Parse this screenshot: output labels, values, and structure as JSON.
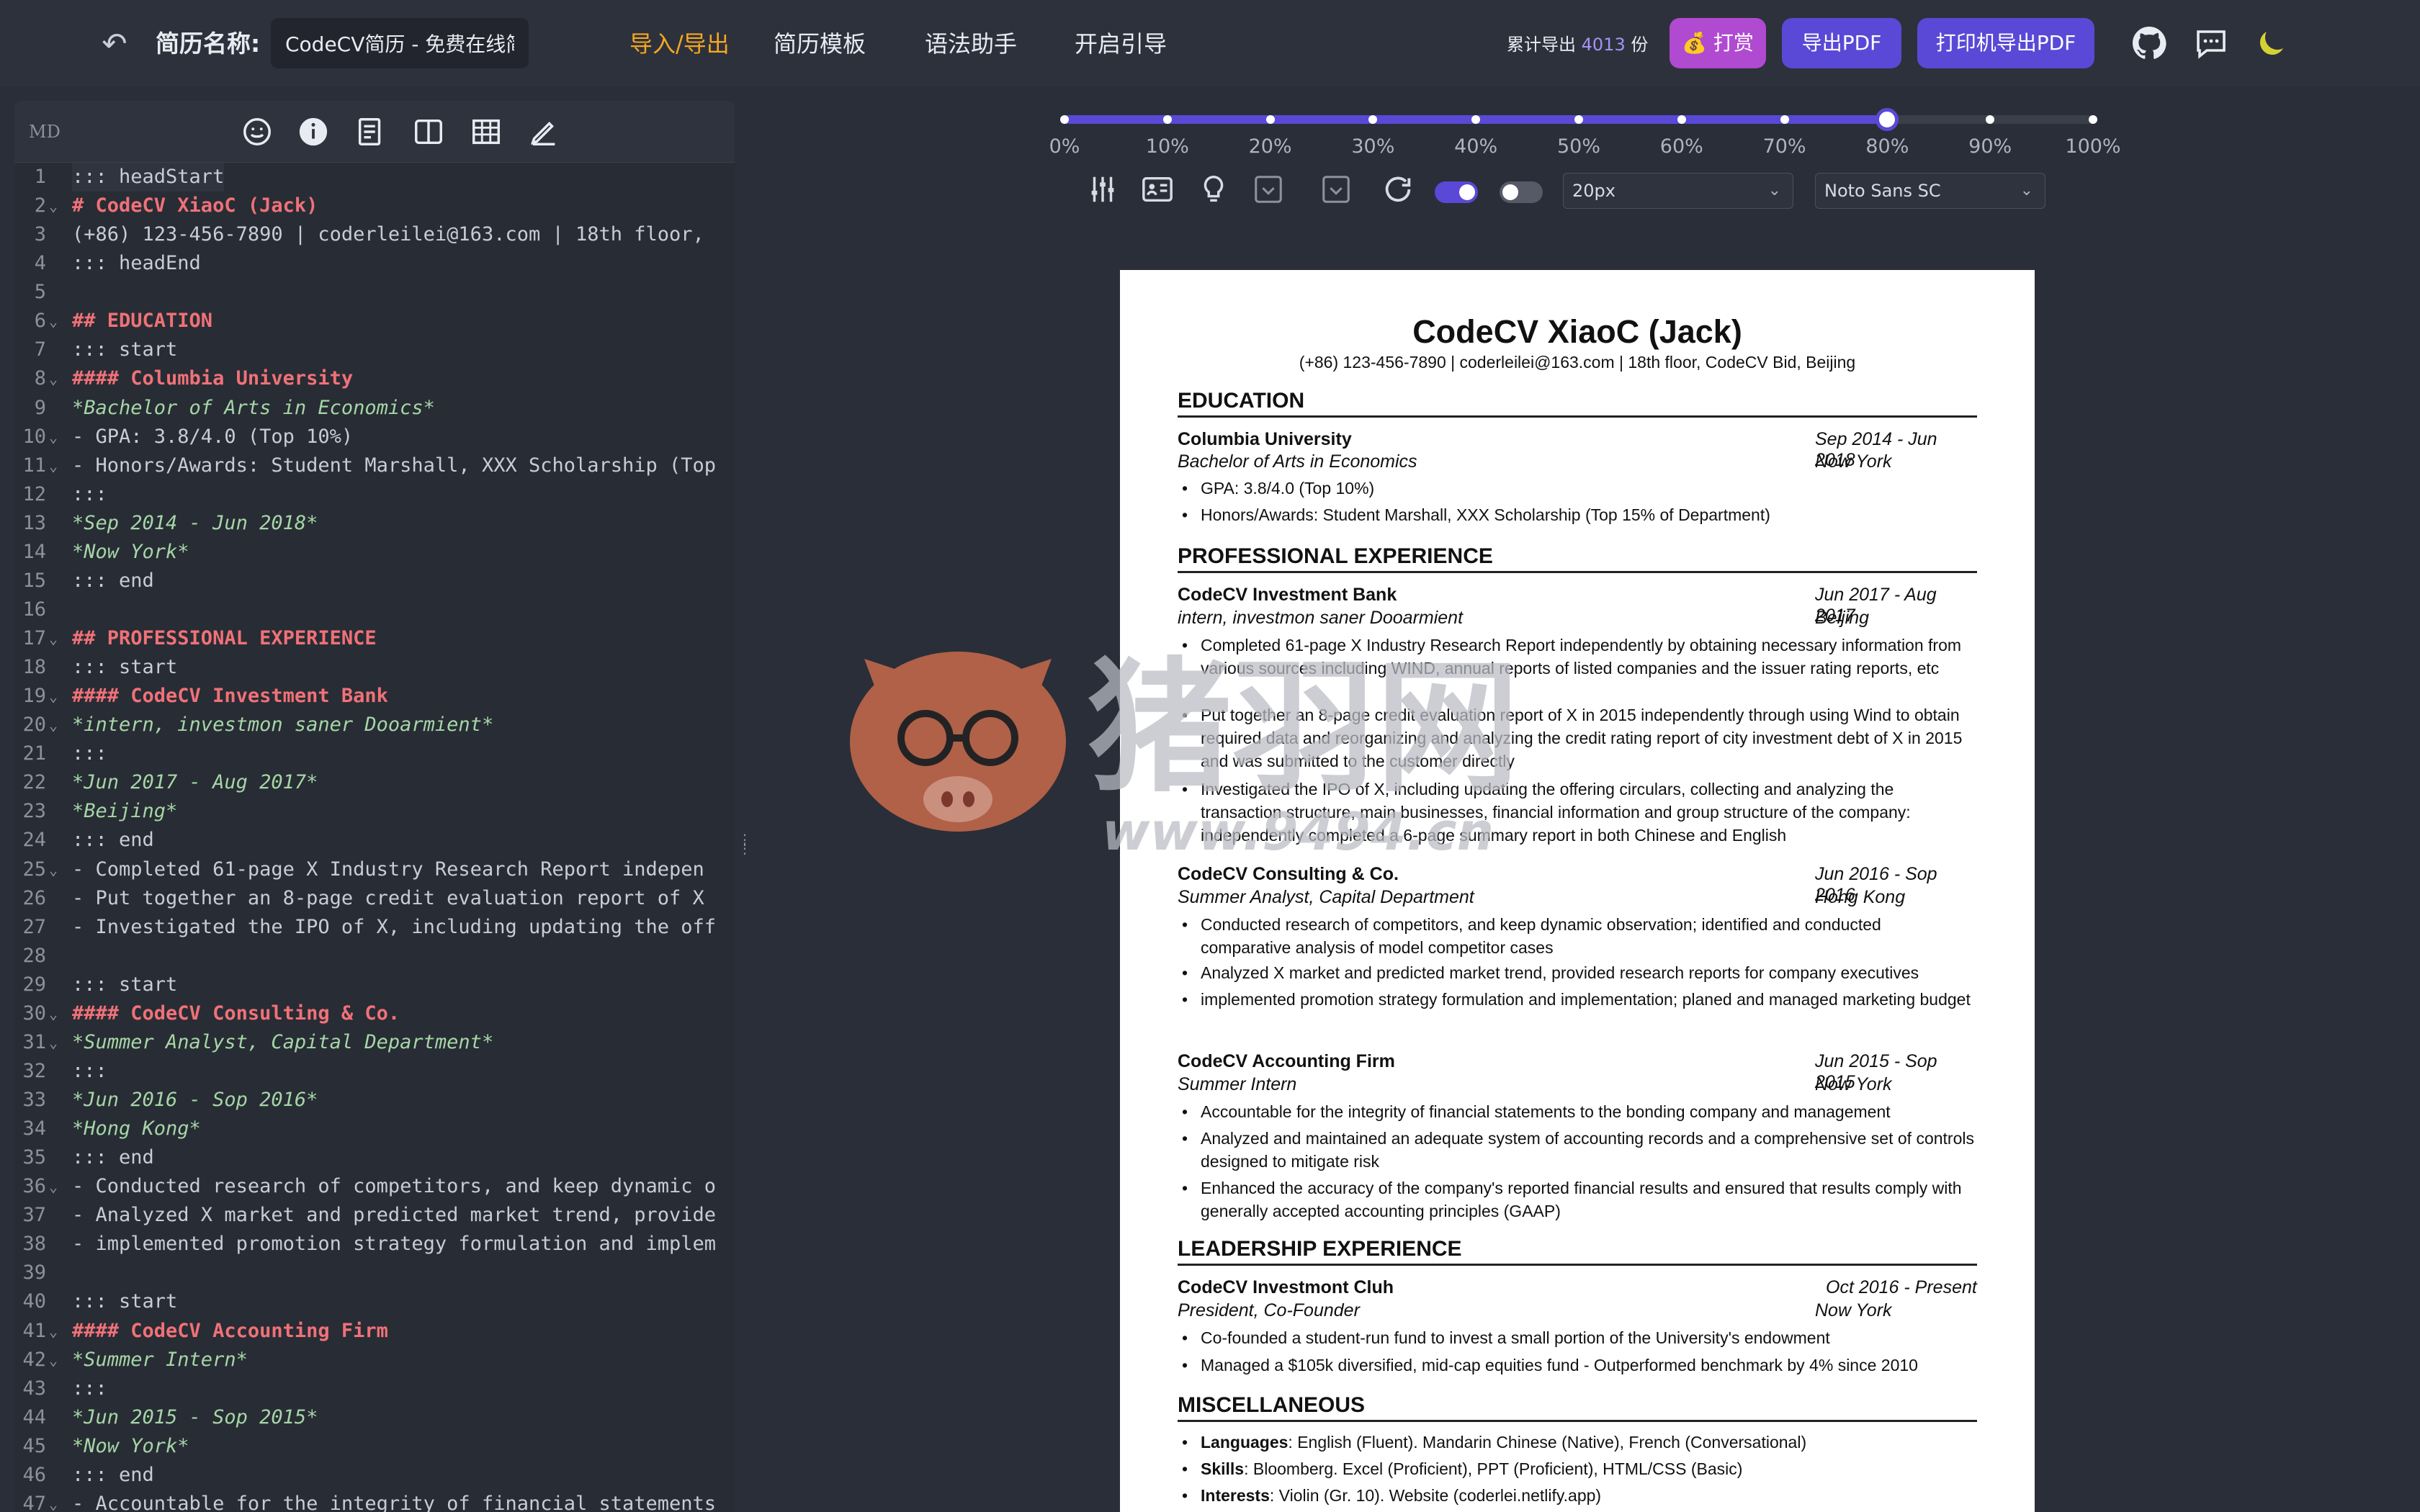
{
  "header": {
    "title_label": "简历名称:",
    "title_value": "CodeCV简历 - 免费在线简历",
    "nav": [
      "导入/导出",
      "简历模板",
      "语法助手",
      "开启引导"
    ],
    "export_prefix": "累计导出",
    "export_count": "4013",
    "export_suffix": "份",
    "buttons": {
      "reward": "打赏",
      "export_pdf": "导出PDF",
      "print_pdf": "打印机导出PDF"
    },
    "icons": [
      "back-icon",
      "github-icon",
      "chat-icon",
      "moon-icon"
    ],
    "accent": "#5a49d6"
  },
  "editor": {
    "mode_label": "MD",
    "toolbar_icons": [
      "emoji-icon",
      "info-icon",
      "document-icon",
      "columns-icon",
      "table-icon",
      "pen-icon"
    ],
    "lines": [
      {
        "n": "1",
        "f": "",
        "t": "::: headStart",
        "c": ""
      },
      {
        "n": "2",
        "f": "⌄",
        "t": "# CodeCV XiaoC (Jack)",
        "c": "h"
      },
      {
        "n": "3",
        "f": "",
        "t": "(+86) 123-456-7890 | coderleilei@163.com | 18th floor,",
        "c": ""
      },
      {
        "n": "4",
        "f": "",
        "t": "::: headEnd",
        "c": ""
      },
      {
        "n": "5",
        "f": "",
        "t": "",
        "c": ""
      },
      {
        "n": "6",
        "f": "⌄",
        "t": "## EDUCATION",
        "c": "h"
      },
      {
        "n": "7",
        "f": "",
        "t": "::: start",
        "c": ""
      },
      {
        "n": "8",
        "f": "⌄",
        "t": "#### Columbia University",
        "c": "h"
      },
      {
        "n": "9",
        "f": "",
        "t": "*Bachelor of Arts in Economics*",
        "c": "em"
      },
      {
        "n": "10",
        "f": "⌄",
        "t": "- GPA: 3.8/4.0 (Top 10%)",
        "c": ""
      },
      {
        "n": "11",
        "f": "⌄",
        "t": "- Honors/Awards: Student Marshall, XXX Scholarship (Top",
        "c": ""
      },
      {
        "n": "12",
        "f": "",
        "t": ":::",
        "c": ""
      },
      {
        "n": "13",
        "f": "",
        "t": "*Sep 2014 - Jun 2018*",
        "c": "em"
      },
      {
        "n": "14",
        "f": "",
        "t": "*Now York*",
        "c": "em"
      },
      {
        "n": "15",
        "f": "",
        "t": "::: end",
        "c": ""
      },
      {
        "n": "16",
        "f": "",
        "t": "",
        "c": ""
      },
      {
        "n": "17",
        "f": "⌄",
        "t": "## PROFESSIONAL EXPERIENCE",
        "c": "h"
      },
      {
        "n": "18",
        "f": "",
        "t": "::: start",
        "c": ""
      },
      {
        "n": "19",
        "f": "⌄",
        "t": "#### CodeCV Investment Bank",
        "c": "h"
      },
      {
        "n": "20",
        "f": "⌄",
        "t": "*intern, investmon saner Dooarmient*",
        "c": "em"
      },
      {
        "n": "21",
        "f": "",
        "t": ":::",
        "c": ""
      },
      {
        "n": "22",
        "f": "",
        "t": "*Jun 2017 - Aug 2017*",
        "c": "em"
      },
      {
        "n": "23",
        "f": "",
        "t": "*Beijing*",
        "c": "em"
      },
      {
        "n": "24",
        "f": "",
        "t": "::: end",
        "c": ""
      },
      {
        "n": "25",
        "f": "⌄",
        "t": "- Completed 61-page X Industry Research Report indepen",
        "c": ""
      },
      {
        "n": "26",
        "f": "",
        "t": "- Put together an 8-page credit evaluation report of X",
        "c": ""
      },
      {
        "n": "27",
        "f": "",
        "t": "- Investigated the IPO of X, including updating the off",
        "c": ""
      },
      {
        "n": "28",
        "f": "",
        "t": "",
        "c": ""
      },
      {
        "n": "29",
        "f": "",
        "t": "::: start",
        "c": ""
      },
      {
        "n": "30",
        "f": "⌄",
        "t": "#### CodeCV Consulting & Co.",
        "c": "h"
      },
      {
        "n": "31",
        "f": "⌄",
        "t": "*Summer Analyst, Capital Department*",
        "c": "em"
      },
      {
        "n": "32",
        "f": "",
        "t": ":::",
        "c": ""
      },
      {
        "n": "33",
        "f": "",
        "t": "*Jun 2016 - Sop 2016*",
        "c": "em"
      },
      {
        "n": "34",
        "f": "",
        "t": "*Hong Kong*",
        "c": "em"
      },
      {
        "n": "35",
        "f": "",
        "t": "::: end",
        "c": ""
      },
      {
        "n": "36",
        "f": "⌄",
        "t": "- Conducted research of competitors, and keep dynamic o",
        "c": ""
      },
      {
        "n": "37",
        "f": "",
        "t": "- Analyzed X market and predicted market trend, provide",
        "c": ""
      },
      {
        "n": "38",
        "f": "",
        "t": "- implemented promotion strategy formulation and implem",
        "c": ""
      },
      {
        "n": "39",
        "f": "",
        "t": "",
        "c": ""
      },
      {
        "n": "40",
        "f": "",
        "t": "::: start",
        "c": ""
      },
      {
        "n": "41",
        "f": "⌄",
        "t": "#### CodeCV Accounting Firm",
        "c": "h"
      },
      {
        "n": "42",
        "f": "⌄",
        "t": "*Summer Intern*",
        "c": "em"
      },
      {
        "n": "43",
        "f": "",
        "t": ":::",
        "c": ""
      },
      {
        "n": "44",
        "f": "",
        "t": "*Jun 2015 - Sop 2015*",
        "c": "em"
      },
      {
        "n": "45",
        "f": "",
        "t": "*Now York*",
        "c": "em"
      },
      {
        "n": "46",
        "f": "",
        "t": "::: end",
        "c": ""
      },
      {
        "n": "47",
        "f": "⌄",
        "t": "- Accountable for the integrity of financial statements",
        "c": ""
      }
    ]
  },
  "preview": {
    "zoom_ticks": [
      "0%",
      "10%",
      "20%",
      "30%",
      "40%",
      "50%",
      "60%",
      "70%",
      "80%",
      "90%",
      "100%"
    ],
    "zoom_value": 0.8,
    "toolbar_icons": [
      "sliders-icon",
      "id-card-icon",
      "lightbulb-icon",
      "checkbox-icon",
      "checkbox-icon-2",
      "refresh-icon"
    ],
    "toggle1_on": true,
    "toggle2_on": false,
    "font_size": "20px",
    "font_family": "Noto Sans SC"
  },
  "resume": {
    "name": "CodeCV XiaoC (Jack)",
    "contact": "(+86) 123-456-7890 | coderleilei@163.com | 18th floor, CodeCV Bid, Beijing",
    "sections": {
      "education": "EDUCATION",
      "experience": "PROFESSIONAL EXPERIENCE",
      "leadership": "LEADERSHIP EXPERIENCE",
      "misc": "MISCELLANEOUS"
    },
    "edu": {
      "org": "Columbia University",
      "role": "Bachelor of Arts in Economics",
      "date": "Sep 2014 - Jun 2018",
      "loc": "Now York",
      "bullets": [
        "GPA: 3.8/4.0 (Top 10%)",
        "Honors/Awards: Student Marshall, XXX Scholarship (Top 15% of Department)"
      ]
    },
    "jobs": [
      {
        "org": "CodeCV Investment Bank",
        "role": "intern, investmon saner Dooarmient",
        "date": "Jun 2017 - Aug 2017",
        "loc": "Beijing",
        "bullets": [
          "Completed 61-page X Industry Research Report independently by obtaining necessary information from various sources including WIND, annual reports of listed companies and the issuer rating reports, etc",
          "Put together an 8-page credit evaluation report of X in 2015 independently through using Wind to obtain required data and reorganizing and analyzing the credit rating report of city investment debt of X in 2015 and was submitted to the customer directly",
          "Investigated the IPO of X, including updating the offering circulars, collecting and analyzing the transaction structure, main businesses, financial information and group structure of the company: independently completed a 6-page summary report in both Chinese and English"
        ]
      },
      {
        "org": "CodeCV Consulting & Co.",
        "role": "Summer Analyst, Capital Department",
        "date": "Jun 2016 - Sop 2016",
        "loc": "Hong Kong",
        "bullets": [
          "Conducted research of competitors, and keep dynamic observation; identified and conducted comparative analysis of model competitor cases",
          "Analyzed X market and predicted market trend, provided research reports for company executives",
          "implemented promotion strategy formulation and implementation; planed and managed marketing budget"
        ]
      },
      {
        "org": "CodeCV Accounting Firm",
        "role": "Summer Intern",
        "date": "Jun 2015 - Sop 2015",
        "loc": "Now York",
        "bullets": [
          "Accountable for the integrity of financial statements to the bonding company and management",
          "Analyzed and maintained an adequate system of accounting records and a comprehensive set of controls designed to mitigate risk",
          "Enhanced the accuracy of the company's reported financial results and ensured that results comply with generally accepted accounting principles (GAAP)"
        ]
      }
    ],
    "lead": {
      "org": "CodeCV Investmont Cluh",
      "role": "President, Co-Founder",
      "date": "Oct 2016 - Present",
      "loc": "Now York",
      "bullets": [
        "Co-founded a student-run fund to invest a small portion of the University's endowment",
        "Managed a $105k diversified, mid-cap equities fund - Outperformed benchmark by 4% since 2010"
      ]
    },
    "misc": [
      {
        "k": "Languages",
        "v": ": English (Fluent). Mandarin Chinese (Native), French (Conversational)"
      },
      {
        "k": "Skills",
        "v": ": Bloomberg. Excel (Proficient), PPT (Proficient), HTML/CSS (Basic)"
      },
      {
        "k": "Interests",
        "v": ": Violin (Gr. 10). Website (coderlei.netlify.app)"
      }
    ]
  },
  "watermark": {
    "text": "猪羽网",
    "url": "www.9494.cn"
  }
}
